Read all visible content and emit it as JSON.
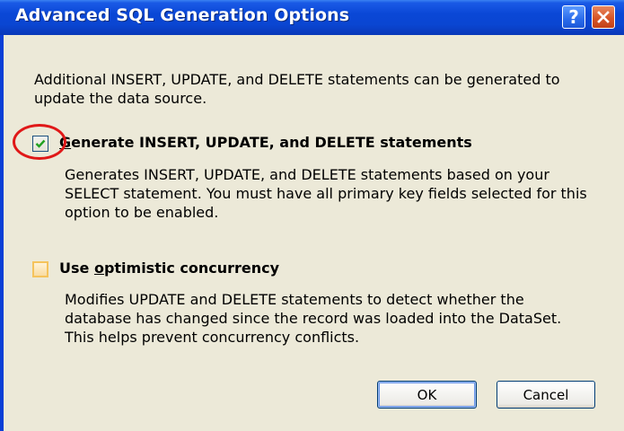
{
  "dialog": {
    "title": "Advanced SQL Generation Options",
    "help_glyph": "?",
    "close_glyph": "✕",
    "intro_line1": "Additional INSERT, UPDATE, and DELETE statements can be generated to",
    "intro_line2": "update the data source."
  },
  "options": [
    {
      "label_mnemonic": "G",
      "label_rest": "enerate INSERT, UPDATE, and DELETE statements",
      "checked": true,
      "desc_lines": [
        "Generates INSERT, UPDATE, and DELETE statements based on your",
        "SELECT statement. You must have all primary key fields selected for this",
        "option to be enabled."
      ]
    },
    {
      "label_pre": "Use ",
      "label_mnemonic": "o",
      "label_rest": "ptimistic concurrency",
      "checked": false,
      "desc_lines": [
        "Modifies UPDATE and DELETE statements to detect whether the",
        "database has changed since the record was loaded into the DataSet.",
        "This helps prevent concurrency conflicts."
      ]
    }
  ],
  "buttons": {
    "ok": "OK",
    "cancel": "Cancel"
  },
  "colors": {
    "titlebar": "#0A47D6",
    "dialog_bg": "#ECE9D8",
    "annotation_circle": "#E01818",
    "check_mark": "#21A121"
  }
}
